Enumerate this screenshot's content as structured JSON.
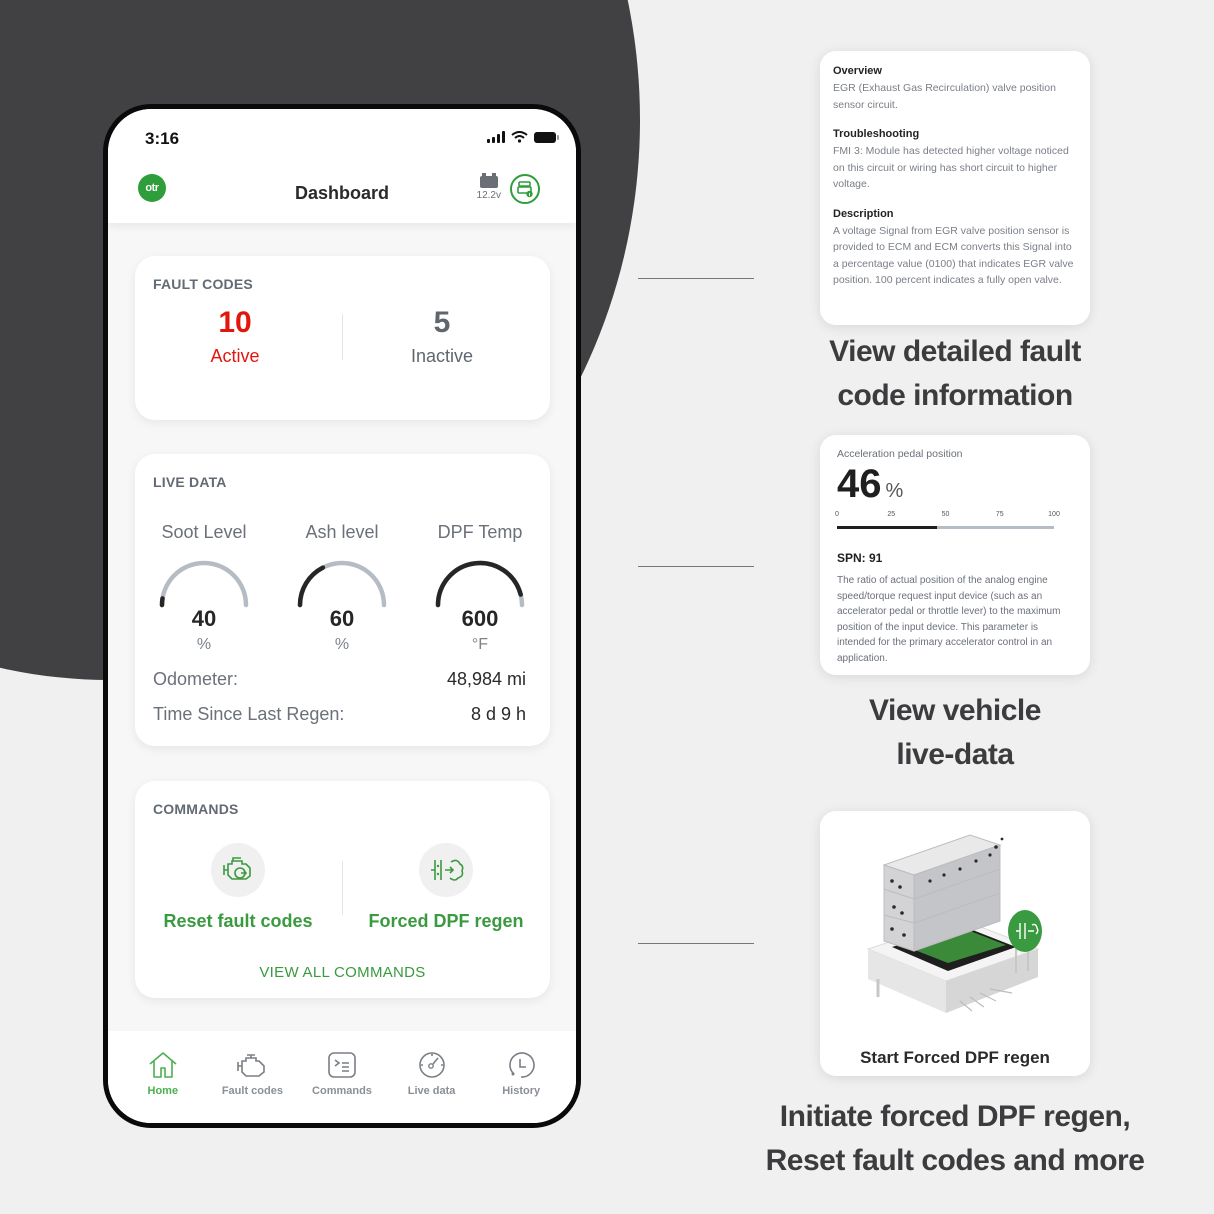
{
  "phone": {
    "status_bar": {
      "time": "3:16"
    },
    "header": {
      "logo_text": "otr",
      "title": "Dashboard",
      "battery_voltage": "12.2v"
    },
    "fault_codes": {
      "title": "FAULT CODES",
      "active": {
        "count": "10",
        "label": "Active",
        "color": "#e3160b"
      },
      "inactive": {
        "count": "5",
        "label": "Inactive",
        "color": "#5f666e"
      }
    },
    "live_data": {
      "title": "LIVE DATA",
      "gauges": [
        {
          "label": "Soot Level",
          "value": "40",
          "unit": "%",
          "fill_fraction": 0.05
        },
        {
          "label": "Ash level",
          "value": "60",
          "unit": "%",
          "fill_fraction": 0.35
        },
        {
          "label": "DPF Temp",
          "value": "600",
          "unit": "°F",
          "fill_fraction": 0.92
        }
      ],
      "stats": [
        {
          "label": "Odometer:",
          "value": "48,984 mi"
        },
        {
          "label": "Time Since Last Regen:",
          "value": "8 d 9 h"
        }
      ]
    },
    "commands": {
      "title": "COMMANDS",
      "items": [
        {
          "label": "Reset fault codes",
          "icon": "engine-reset-icon"
        },
        {
          "label": "Forced DPF regen",
          "icon": "dpf-regen-icon"
        }
      ],
      "view_all": "VIEW ALL COMMANDS"
    },
    "tabbar": [
      {
        "label": "Home",
        "icon": "home-icon",
        "active": true
      },
      {
        "label": "Fault codes",
        "icon": "engine-icon",
        "active": false
      },
      {
        "label": "Commands",
        "icon": "terminal-icon",
        "active": false
      },
      {
        "label": "Live data",
        "icon": "gauge-icon",
        "active": false
      },
      {
        "label": "History",
        "icon": "history-icon",
        "active": false
      }
    ]
  },
  "features": {
    "fault_detail": {
      "sections": [
        {
          "heading": "Overview",
          "text": "EGR (Exhaust Gas Recirculation) valve position sensor circuit."
        },
        {
          "heading": "Troubleshooting",
          "text": "FMI 3: Module has detected higher voltage noticed on this circuit or wiring has short circuit to higher voltage."
        },
        {
          "heading": "Description",
          "text": "A voltage Signal from EGR valve position sensor is provided to ECM and ECM converts this Signal into a percentage value (0100) that indicates EGR valve position. 100 percent indicates a fully open valve."
        }
      ],
      "headline_line1": "View detailed fault",
      "headline_line2": "code information"
    },
    "live_detail": {
      "title": "Acceleration pedal position",
      "value": "46",
      "unit": "%",
      "fill_fraction": 0.46,
      "scale_ticks": [
        "0",
        "25",
        "50",
        "75",
        "100"
      ],
      "spn": "SPN: 91",
      "description": "The ratio of actual position of the analog engine speed/torque request input device (such as an accelerator pedal or throttle lever) to the maximum position of the input device.  This parameter is intended for the primary accelerator control in an application.",
      "headline_line1": "View vehicle",
      "headline_line2": "live-data"
    },
    "regen": {
      "caption": "Start Forced DPF regen",
      "headline_line1": "Initiate forced DPF regen,",
      "headline_line2": "Reset fault codes and more"
    }
  },
  "colors": {
    "brand_green": "#2e9e3a",
    "command_green": "#3a9a3f",
    "gauge_fill": "#262626",
    "gauge_track": "#b6bcc3",
    "dark_bg": "#414143"
  }
}
